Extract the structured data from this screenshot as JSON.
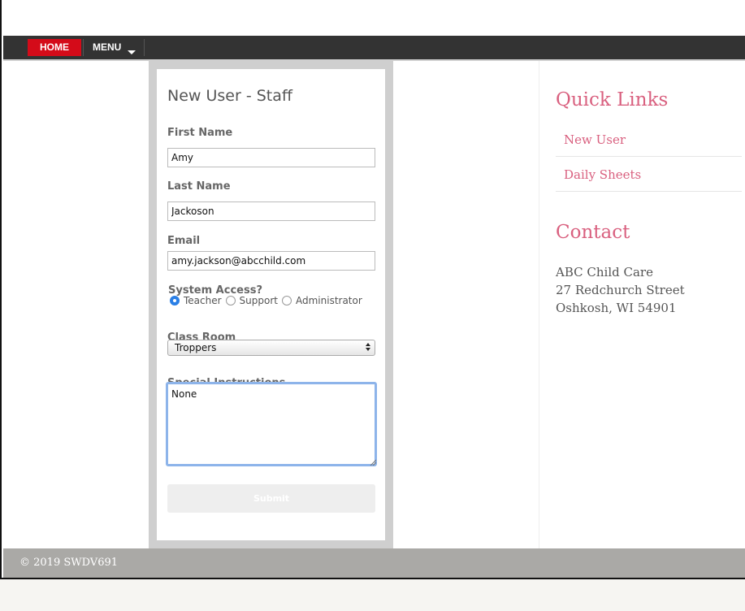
{
  "nav": {
    "home_label": "HOME",
    "menu_label": "MENU"
  },
  "form": {
    "title": "New User - Staff",
    "first_name_label": "First Name",
    "first_name_value": "Amy",
    "last_name_label": "Last Name",
    "last_name_value": "Jackoson",
    "email_label": "Email",
    "email_value": "amy.jackson@abcchild.com",
    "access_label": "System Access?",
    "access_options": [
      {
        "label": "Teacher",
        "checked": true
      },
      {
        "label": "Support",
        "checked": false
      },
      {
        "label": "Administrator",
        "checked": false
      }
    ],
    "classroom_label": "Class Room",
    "classroom_value": "Troppers",
    "instructions_label": "Special Instructions",
    "instructions_value": "None",
    "submit_label": "Submit"
  },
  "sidebar": {
    "quick_links_heading": "Quick Links",
    "links": [
      {
        "label": "New User"
      },
      {
        "label": "Daily Sheets"
      }
    ],
    "contact_heading": "Contact",
    "address": [
      "ABC Child Care",
      "27 Redchurch Street",
      "Oshkosh, WI 54901"
    ]
  },
  "footer": {
    "copyright": "© 2019 SWDV691"
  },
  "colors": {
    "nav_bg": "#333333",
    "home_active": "#d40b19",
    "accent_pink": "#d9607f",
    "focus_blue": "#8db4ea",
    "radio_blue": "#2a7fe6",
    "footer_bg": "#aaa9a6"
  },
  "icons": {
    "menu_caret": "chevron-down-icon",
    "select_arrows": "select-arrows-icon",
    "resize_grip": "resize-grip-icon"
  }
}
